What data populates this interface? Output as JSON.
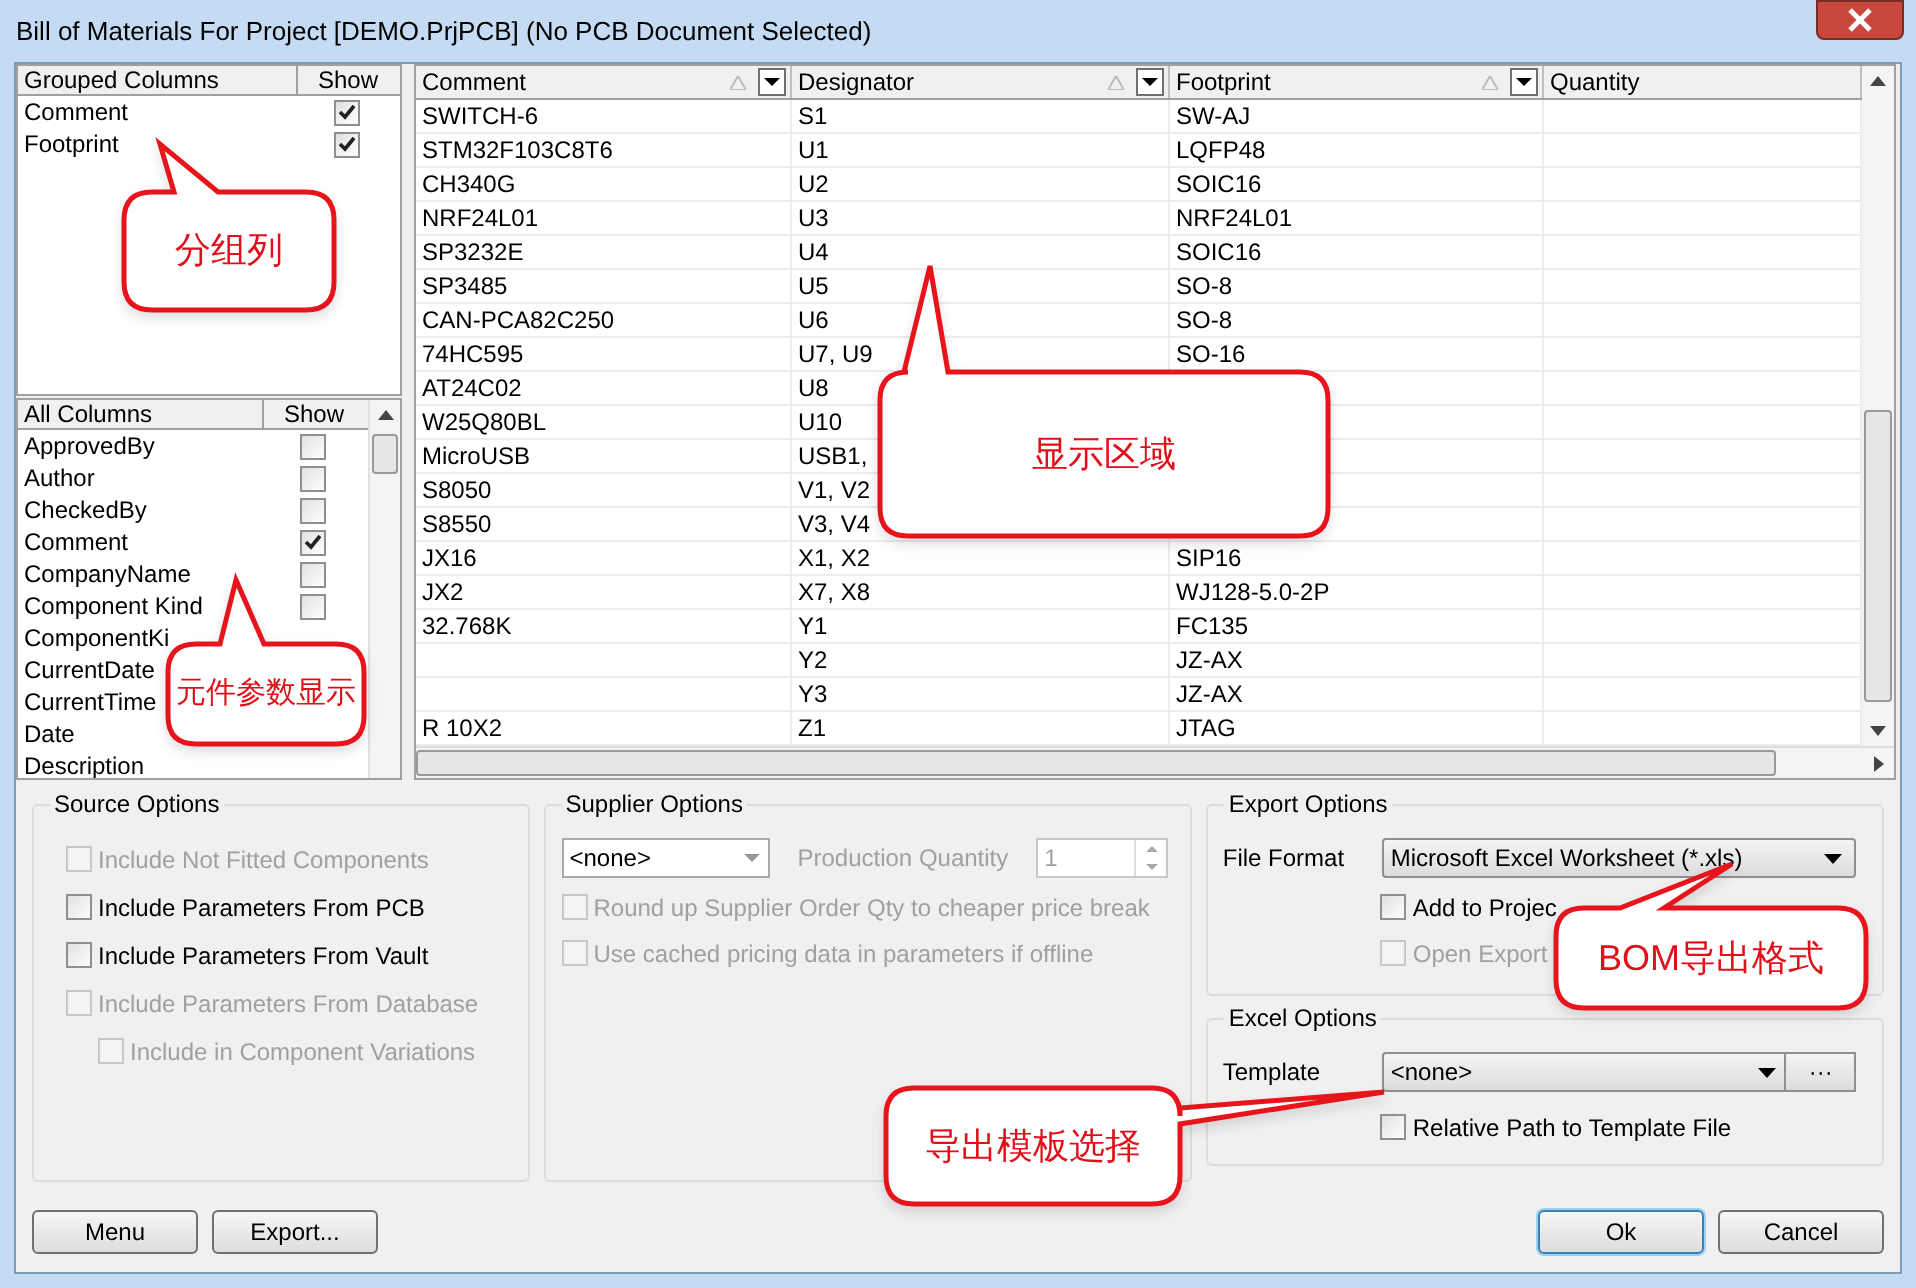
{
  "window": {
    "title": "Bill of Materials For Project [DEMO.PrjPCB] (No PCB Document Selected)"
  },
  "grouped_columns": {
    "columns": [
      "Grouped Columns",
      "Show"
    ],
    "items": [
      {
        "label": "Comment",
        "checked": true
      },
      {
        "label": "Footprint",
        "checked": true
      }
    ]
  },
  "all_columns": {
    "columns": [
      "All Columns",
      "Show"
    ],
    "items": [
      {
        "label": "ApprovedBy",
        "checked": false
      },
      {
        "label": "Author",
        "checked": false
      },
      {
        "label": "CheckedBy",
        "checked": false
      },
      {
        "label": "Comment",
        "checked": true
      },
      {
        "label": "CompanyName",
        "checked": false
      },
      {
        "label": "Component Kind",
        "checked": false
      },
      {
        "label": "ComponentKi"
      },
      {
        "label": "CurrentDate"
      },
      {
        "label": "CurrentTime"
      },
      {
        "label": "Date"
      },
      {
        "label": "Description"
      }
    ]
  },
  "table": {
    "columns": [
      "Comment",
      "Designator",
      "Footprint",
      "Quantity"
    ],
    "rows": [
      [
        "SWITCH-6",
        "S1",
        "SW-AJ"
      ],
      [
        "STM32F103C8T6",
        "U1",
        "LQFP48"
      ],
      [
        "CH340G",
        "U2",
        "SOIC16"
      ],
      [
        "NRF24L01",
        "U3",
        "NRF24L01"
      ],
      [
        "SP3232E",
        "U4",
        "SOIC16"
      ],
      [
        "SP3485",
        "U5",
        "SO-8"
      ],
      [
        "CAN-PCA82C250",
        "U6",
        "SO-8"
      ],
      [
        "74HC595",
        "U7, U9",
        "SO-16"
      ],
      [
        "AT24C02",
        "U8",
        ""
      ],
      [
        "W25Q80BL",
        "U10",
        ""
      ],
      [
        "MicroUSB",
        "USB1,",
        ""
      ],
      [
        "S8050",
        "V1, V2",
        ""
      ],
      [
        "S8550",
        "V3, V4",
        ""
      ],
      [
        "JX16",
        "X1, X2",
        "SIP16"
      ],
      [
        "JX2",
        "X7, X8",
        "WJ128-5.0-2P"
      ],
      [
        "32.768K",
        "Y1",
        "FC135"
      ],
      [
        "",
        "Y2",
        "JZ-AX"
      ],
      [
        "",
        "Y3",
        "JZ-AX"
      ],
      [
        "R 10X2",
        "Z1",
        "JTAG"
      ]
    ]
  },
  "source_options": {
    "title": "Source Options",
    "items": [
      {
        "label": "Include Not Fitted Components",
        "checked": false,
        "disabled": true
      },
      {
        "label": "Include Parameters From PCB",
        "checked": false,
        "disabled": false
      },
      {
        "label": "Include Parameters From Vault",
        "checked": false,
        "disabled": false
      },
      {
        "label": "Include Parameters From Database",
        "checked": false,
        "disabled": true
      },
      {
        "label": "Include in Component Variations",
        "checked": false,
        "disabled": true,
        "nested": true
      }
    ]
  },
  "supplier_options": {
    "title": "Supplier Options",
    "supplier": "<none>",
    "quantity_label": "Production Quantity",
    "quantity": "1",
    "items": [
      {
        "label": "Round up Supplier Order Qty to cheaper price break",
        "checked": false,
        "disabled": true
      },
      {
        "label": "Use cached pricing data in parameters if offline",
        "checked": false,
        "disabled": true
      }
    ]
  },
  "export_options": {
    "title": "Export Options",
    "file_format_label": "File Format",
    "file_format": "Microsoft Excel Worksheet (*.xls)",
    "items": [
      {
        "label": "Add to Projec",
        "checked": false,
        "disabled": false
      },
      {
        "label": "Open Export",
        "checked": false,
        "disabled": true
      }
    ]
  },
  "excel_options": {
    "title": "Excel Options",
    "template_label": "Template",
    "template": "<none>",
    "browse": "···",
    "items": [
      {
        "label": "Relative Path to Template File",
        "checked": false,
        "disabled": false
      }
    ]
  },
  "buttons": [
    "Menu",
    "Export...",
    "Ok",
    "Cancel"
  ],
  "callouts": [
    "分组列",
    "显示区域",
    "元件参数显示",
    "BOM导出格式",
    "导出模板选择"
  ]
}
